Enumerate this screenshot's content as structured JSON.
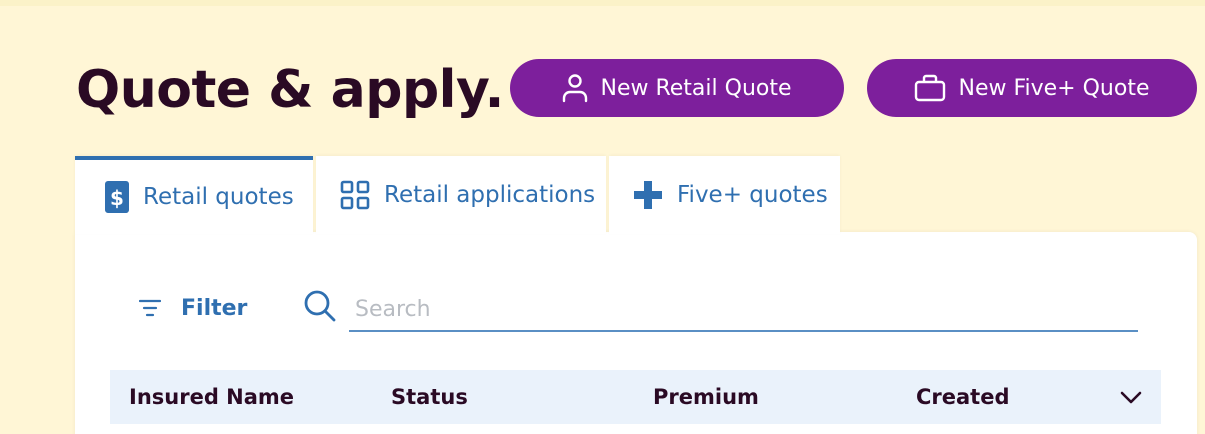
{
  "header": {
    "title": "Quote & apply."
  },
  "actions": {
    "new_retail_quote": {
      "label": "New Retail Quote",
      "icon": "person-icon"
    },
    "new_five_plus_quote": {
      "label": "New Five+ Quote",
      "icon": "briefcase-icon"
    }
  },
  "tabs": [
    {
      "label": "Retail quotes",
      "icon": "dollar-icon",
      "active": true
    },
    {
      "label": "Retail applications",
      "icon": "grid-icon",
      "active": false
    },
    {
      "label": "Five+ quotes",
      "icon": "plus-icon",
      "active": false
    }
  ],
  "toolbar": {
    "filter_label": "Filter",
    "filter_icon": "filter-icon",
    "search_icon": "search-icon",
    "search_placeholder": "Search",
    "search_value": ""
  },
  "table": {
    "columns": [
      "Insured Name",
      "Status",
      "Premium",
      "Created"
    ],
    "sort_icon": "chevron-down-icon"
  },
  "colors": {
    "page_background": "#fff6d6",
    "brand_purple": "#7d1f9c",
    "title_text": "#2a0a24",
    "accent_blue": "#2f6fb0",
    "table_header_bg": "#eaf2fb",
    "placeholder_gray": "#b8bcc2"
  }
}
